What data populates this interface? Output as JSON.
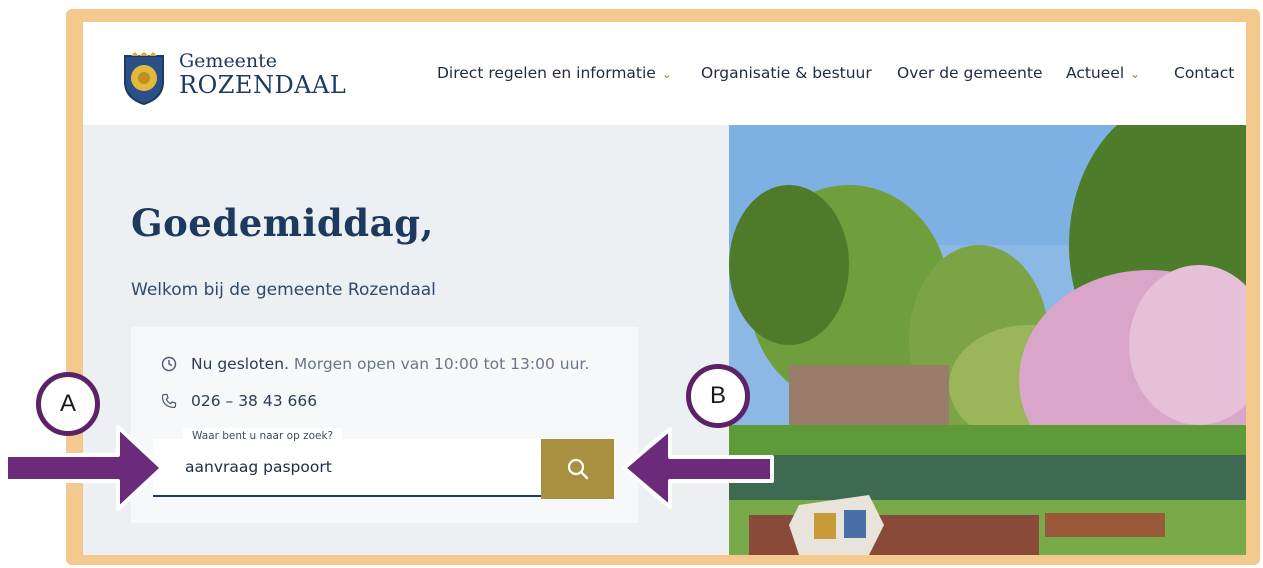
{
  "logo": {
    "line1": "Gemeente",
    "line2": "ROZENDAAL"
  },
  "nav": {
    "items": [
      {
        "label": "Direct regelen en informatie",
        "dropdown": true
      },
      {
        "label": "Organisatie & bestuur",
        "dropdown": false
      },
      {
        "label": "Over de gemeente",
        "dropdown": false
      },
      {
        "label": "Actueel",
        "dropdown": true
      },
      {
        "label": "Contact",
        "dropdown": false
      }
    ]
  },
  "hero": {
    "greeting": "Goedemiddag,",
    "welcome": "Welkom bij de gemeente Rozendaal"
  },
  "info": {
    "status_strong": "Nu gesloten.",
    "status_rest": "Morgen open van 10:00 tot 13:00 uur.",
    "phone": "026 – 38 43 666"
  },
  "search": {
    "label": "Waar bent u naar op zoek?",
    "value": "aanvraag paspoort"
  },
  "annotations": {
    "marker_a": "A",
    "marker_b": "B"
  },
  "colors": {
    "frame": "#f4c98e",
    "navy": "#1d3a5e",
    "gold": "#a99040",
    "annotation_purple": "#6b2a7a"
  }
}
